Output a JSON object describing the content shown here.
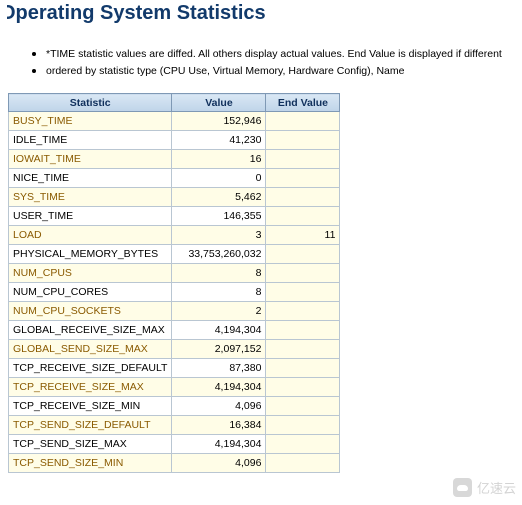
{
  "header": {
    "title": "Operating System Statistics"
  },
  "notes": [
    "*TIME statistic values are diffed. All others display actual values. End Value is displayed if different",
    "ordered by statistic type (CPU Use, Virtual Memory, Hardware Config), Name"
  ],
  "table": {
    "columns": [
      "Statistic",
      "Value",
      "End Value"
    ],
    "rows": [
      {
        "name": "BUSY_TIME",
        "value": "152,946",
        "end_value": "",
        "highlight": true
      },
      {
        "name": "IDLE_TIME",
        "value": "41,230",
        "end_value": "",
        "highlight": false
      },
      {
        "name": "IOWAIT_TIME",
        "value": "16",
        "end_value": "",
        "highlight": true
      },
      {
        "name": "NICE_TIME",
        "value": "0",
        "end_value": "",
        "highlight": false
      },
      {
        "name": "SYS_TIME",
        "value": "5,462",
        "end_value": "",
        "highlight": true
      },
      {
        "name": "USER_TIME",
        "value": "146,355",
        "end_value": "",
        "highlight": false
      },
      {
        "name": "LOAD",
        "value": "3",
        "end_value": "11",
        "highlight": true
      },
      {
        "name": "PHYSICAL_MEMORY_BYTES",
        "value": "33,753,260,032",
        "end_value": "",
        "highlight": false
      },
      {
        "name": "NUM_CPUS",
        "value": "8",
        "end_value": "",
        "highlight": true
      },
      {
        "name": "NUM_CPU_CORES",
        "value": "8",
        "end_value": "",
        "highlight": false
      },
      {
        "name": "NUM_CPU_SOCKETS",
        "value": "2",
        "end_value": "",
        "highlight": true
      },
      {
        "name": "GLOBAL_RECEIVE_SIZE_MAX",
        "value": "4,194,304",
        "end_value": "",
        "highlight": false
      },
      {
        "name": "GLOBAL_SEND_SIZE_MAX",
        "value": "2,097,152",
        "end_value": "",
        "highlight": true
      },
      {
        "name": "TCP_RECEIVE_SIZE_DEFAULT",
        "value": "87,380",
        "end_value": "",
        "highlight": false
      },
      {
        "name": "TCP_RECEIVE_SIZE_MAX",
        "value": "4,194,304",
        "end_value": "",
        "highlight": true
      },
      {
        "name": "TCP_RECEIVE_SIZE_MIN",
        "value": "4,096",
        "end_value": "",
        "highlight": false
      },
      {
        "name": "TCP_SEND_SIZE_DEFAULT",
        "value": "16,384",
        "end_value": "",
        "highlight": true
      },
      {
        "name": "TCP_SEND_SIZE_MAX",
        "value": "4,194,304",
        "end_value": "",
        "highlight": false
      },
      {
        "name": "TCP_SEND_SIZE_MIN",
        "value": "4,096",
        "end_value": "",
        "highlight": true
      }
    ]
  },
  "watermark": {
    "text": "亿速云"
  }
}
